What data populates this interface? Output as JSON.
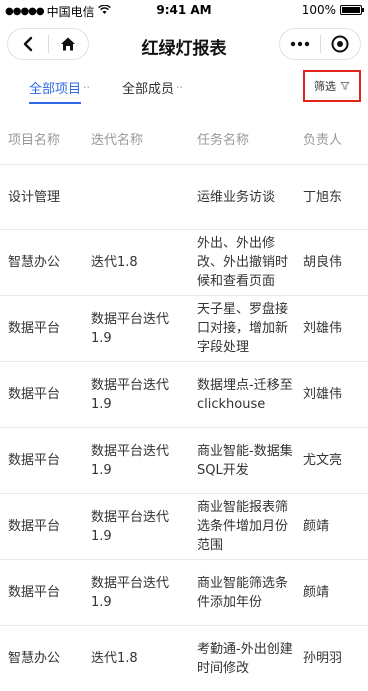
{
  "status_bar": {
    "carrier": "中国电信",
    "time": "9:41 AM",
    "battery": "100%"
  },
  "nav": {
    "title": "红绿灯报表"
  },
  "filters": {
    "tab_projects": "全部项目",
    "tab_members": "全部成员",
    "filter_label": "筛选"
  },
  "table": {
    "headers": [
      "项目名称",
      "迭代名称",
      "任务名称",
      "负责人"
    ],
    "rows": [
      {
        "project": "设计管理",
        "iteration": "",
        "task": "运维业务访谈",
        "owner": "丁旭东"
      },
      {
        "project": "智慧办公",
        "iteration": "迭代1.8",
        "task": "外出、外出修改、外出撤销时候和查看页面",
        "owner": "胡良伟"
      },
      {
        "project": "数据平台",
        "iteration": "数据平台迭代1.9",
        "task": "天子星、罗盘接口对接，增加新字段处理",
        "owner": "刘雄伟"
      },
      {
        "project": "数据平台",
        "iteration": "数据平台迭代1.9",
        "task": "数据埋点-迁移至clickhouse",
        "owner": "刘雄伟"
      },
      {
        "project": "数据平台",
        "iteration": "数据平台迭代1.9",
        "task": "商业智能-数据集SQL开发",
        "owner": "尤文亮"
      },
      {
        "project": "数据平台",
        "iteration": "数据平台迭代1.9",
        "task": "商业智能报表筛选条件增加月份范围",
        "owner": "颜靖"
      },
      {
        "project": "数据平台",
        "iteration": "数据平台迭代1.9",
        "task": "商业智能筛选条件添加年份",
        "owner": "颜靖"
      },
      {
        "project": "智慧办公",
        "iteration": "迭代1.8",
        "task": "考勤通-外出创建时间修改",
        "owner": "孙明羽"
      }
    ]
  }
}
